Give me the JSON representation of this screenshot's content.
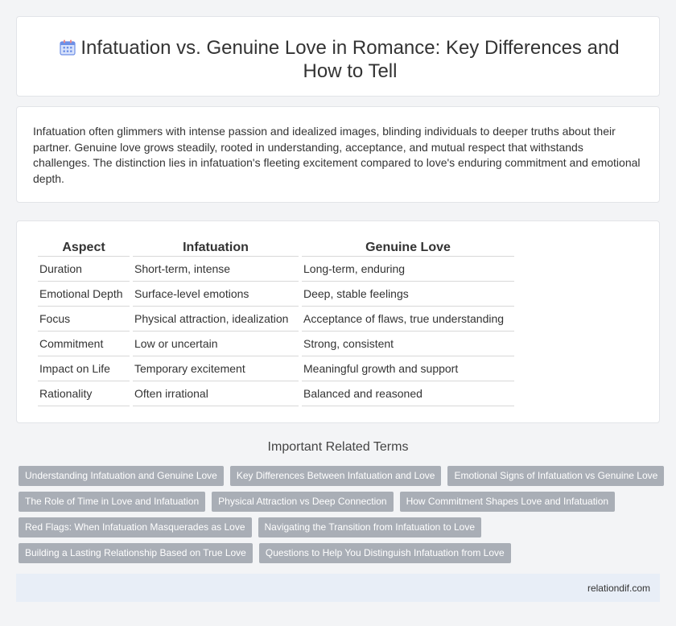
{
  "header": {
    "title": "Infatuation vs. Genuine Love in Romance: Key Differences and How to Tell",
    "icon": "calendar-icon",
    "icon_color": "#6d8fe6"
  },
  "intro": {
    "text": "Infatuation often glimmers with intense passion and idealized images, blinding individuals to deeper truths about their partner. Genuine love grows steadily, rooted in understanding, acceptance, and mutual respect that withstands challenges. The distinction lies in infatuation's fleeting excitement compared to love's enduring commitment and emotional depth."
  },
  "table": {
    "headers": [
      "Aspect",
      "Infatuation",
      "Genuine Love"
    ],
    "rows": [
      [
        "Duration",
        "Short-term, intense",
        "Long-term, enduring"
      ],
      [
        "Emotional Depth",
        "Surface-level emotions",
        "Deep, stable feelings"
      ],
      [
        "Focus",
        "Physical attraction, idealization",
        "Acceptance of flaws, true understanding"
      ],
      [
        "Commitment",
        "Low or uncertain",
        "Strong, consistent"
      ],
      [
        "Impact on Life",
        "Temporary excitement",
        "Meaningful growth and support"
      ],
      [
        "Rationality",
        "Often irrational",
        "Balanced and reasoned"
      ]
    ]
  },
  "related": {
    "title": "Important Related Terms",
    "rows": [
      [
        "Understanding Infatuation and Genuine Love",
        "Key Differences Between Infatuation and Love",
        "Emotional Signs of Infatuation vs Genuine Love"
      ],
      [
        "The Role of Time in Love and Infatuation",
        "Physical Attraction vs Deep Connection",
        "How Commitment Shapes Love and Infatuation"
      ],
      [
        "Red Flags: When Infatuation Masquerades as Love",
        "Navigating the Transition from Infatuation to Love"
      ],
      [
        "Building a Lasting Relationship Based on True Love",
        "Questions to Help You Distinguish Infatuation from Love"
      ]
    ],
    "tag_color": "#a9aeb6"
  },
  "footer": {
    "site": "relationdif.com"
  }
}
